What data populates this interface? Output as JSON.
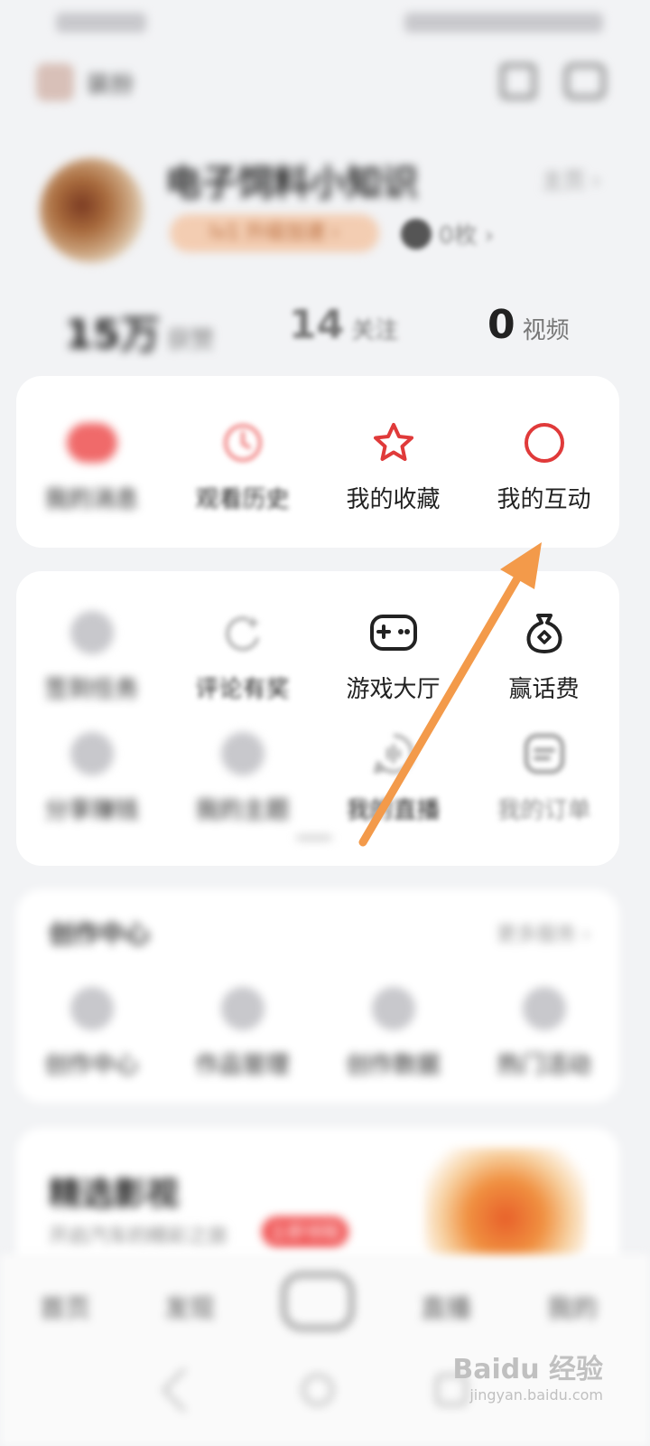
{
  "status_bar": {},
  "top_bar": {
    "icon": "pet-icon",
    "label": "装扮",
    "scan_icon": "scan-icon",
    "message_icon": "message-icon"
  },
  "profile": {
    "name": "电子饲料小知识",
    "link": "主页 ›",
    "level": "lv1 升级加速 ›",
    "coins": "0枚 ›"
  },
  "stats": [
    {
      "num": "15万",
      "label": "获赞"
    },
    {
      "num": "14",
      "label": "关注"
    },
    {
      "num": "0",
      "label": "视频"
    }
  ],
  "quick_row": [
    {
      "label": "我的消息",
      "icon": "message-badge-icon"
    },
    {
      "label": "观看历史",
      "icon": "clock-icon"
    },
    {
      "label": "我的收藏",
      "icon": "star-icon"
    },
    {
      "label": "我的互动",
      "icon": "circle-icon"
    }
  ],
  "tools_row1": [
    {
      "label": "签到任务",
      "icon": "checkin-icon"
    },
    {
      "label": "评论有奖",
      "icon": "sparkle-moon-icon"
    },
    {
      "label": "游戏大厅",
      "icon": "gamepad-icon"
    },
    {
      "label": "赢话费",
      "icon": "money-bag-icon"
    }
  ],
  "tools_row2": [
    {
      "label": "分享赚钱",
      "icon": "share-icon"
    },
    {
      "label": "我的主题",
      "icon": "theme-icon"
    },
    {
      "label": "我的直播",
      "icon": "live-icon"
    },
    {
      "label": "我的订单",
      "icon": "order-icon"
    }
  ],
  "creator": {
    "title": "创作中心",
    "more": "更多服务 ›",
    "items": [
      "创作中心",
      "作品管理",
      "创作数据",
      "热门活动"
    ]
  },
  "banner": {
    "title": "精选影视",
    "subtitle": "开启汽车的精彩之旅",
    "tag": "立即领取"
  },
  "bottom_nav": [
    "首页",
    "发现",
    "直播",
    "我的"
  ],
  "watermark": {
    "main": "Baidu 经验",
    "sub": "jingyan.baidu.com"
  },
  "colors": {
    "accent_red": "#e03a3a",
    "arrow_orange": "#f39a4a"
  }
}
